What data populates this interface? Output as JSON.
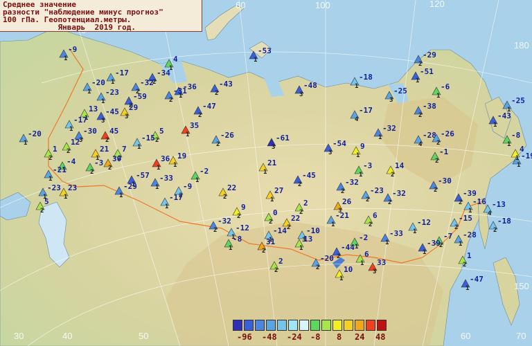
{
  "title": {
    "lines": [
      "Среднее значение",
      "разности \"наблюдение минус прогноз\"",
      "100 гПа. Геопотенциал.метры.",
      "            Январь  2019 год."
    ]
  },
  "legend": {
    "colors": [
      "#2f2fb8",
      "#3b5fd8",
      "#4a86e0",
      "#5aa4e4",
      "#74c4ec",
      "#9ee6f4",
      "#d8f6f8",
      "#5cd65c",
      "#a6e64a",
      "#f0f020",
      "#f4d020",
      "#f0a818",
      "#f04020",
      "#c01010"
    ],
    "labels": [
      "-96",
      "-48",
      "-24",
      "-8",
      "8",
      "24",
      "48"
    ]
  },
  "grid_labels": {
    "longitudes": [
      "40",
      "60",
      "70",
      "80",
      "100",
      "120",
      "140",
      "150",
      "160",
      "170",
      "180",
      "30",
      "40",
      "50",
      "60",
      "70"
    ],
    "latitudes_right": [
      "180",
      "170",
      "160",
      "150",
      "140",
      "130",
      "120",
      "110"
    ]
  },
  "stations": [
    {
      "v": "-9",
      "n": "1",
      "c": "#4a86e0"
    },
    {
      "v": "4",
      "n": "1",
      "c": "#5cd65c"
    },
    {
      "v": "-53",
      "n": "1",
      "c": "#3b5fd8"
    },
    {
      "v": "-17",
      "n": "1",
      "c": "#5aa4e4"
    },
    {
      "v": "-34",
      "n": "2",
      "c": "#3b5fd8"
    },
    {
      "v": "-20",
      "n": "1",
      "c": "#5aa4e4"
    },
    {
      "v": "-32",
      "n": "2",
      "c": "#4a86e0"
    },
    {
      "v": "-23",
      "n": "1",
      "c": "#5aa4e4"
    },
    {
      "v": "-36",
      "n": "1",
      "c": "#3b5fd8"
    },
    {
      "v": "-43",
      "n": "2",
      "c": "#3b5fd8"
    },
    {
      "v": "-48",
      "n": "3",
      "c": "#3b5fd8"
    },
    {
      "v": "-18",
      "n": "1",
      "c": "#74c4ec"
    },
    {
      "v": "-29",
      "n": "2",
      "c": "#4a86e0"
    },
    {
      "v": "-51",
      "n": "1",
      "c": "#3b5fd8"
    },
    {
      "v": "-47",
      "n": "2",
      "c": "#3b5fd8"
    },
    {
      "v": "-59",
      "n": "2",
      "c": "#3b5fd8"
    },
    {
      "v": "-31",
      "n": "2",
      "c": "#4a86e0"
    },
    {
      "v": "-25",
      "n": "3",
      "c": "#5aa4e4"
    },
    {
      "v": "-6",
      "n": "1",
      "c": "#5cd65c"
    },
    {
      "v": "-25",
      "n": "1",
      "c": "#5aa4e4"
    },
    {
      "v": "13",
      "n": "1",
      "c": "#a6e64a"
    },
    {
      "v": "-45",
      "n": "3",
      "c": "#3b5fd8"
    },
    {
      "v": "29",
      "n": "3",
      "c": "#f4d020"
    },
    {
      "v": "-17",
      "n": "4",
      "c": "#5aa4e4"
    },
    {
      "v": "-38",
      "n": "2",
      "c": "#4a86e0"
    },
    {
      "v": "-43",
      "n": "1",
      "c": "#3b5fd8"
    },
    {
      "v": "-17",
      "n": "1",
      "c": "#74c4ec"
    },
    {
      "v": "-30",
      "n": "3",
      "c": "#4a86e0"
    },
    {
      "v": "35",
      "n": "1",
      "c": "#f04020"
    },
    {
      "v": "5",
      "n": "2",
      "c": "#a6e64a"
    },
    {
      "v": "-26",
      "n": "2",
      "c": "#5aa4e4"
    },
    {
      "v": "-61",
      "n": "3",
      "c": "#2f2fb8"
    },
    {
      "v": "-32",
      "n": "1",
      "c": "#4a86e0"
    },
    {
      "v": "-28",
      "n": "4",
      "c": "#5aa4e4"
    },
    {
      "v": "-26",
      "n": "2",
      "c": "#5aa4e4"
    },
    {
      "v": "-8",
      "n": "1",
      "c": "#5cd65c"
    },
    {
      "v": "-20",
      "n": "1",
      "c": "#5aa4e4"
    },
    {
      "v": "-19",
      "n": "1",
      "c": "#5aa4e4"
    },
    {
      "v": "12",
      "n": "2",
      "c": "#a6e64a"
    },
    {
      "v": "45",
      "n": "2",
      "c": "#f04020"
    },
    {
      "v": "-15",
      "n": "1",
      "c": "#74c4ec"
    },
    {
      "v": "-54",
      "n": "3",
      "c": "#3b5fd8"
    },
    {
      "v": "9",
      "n": "1",
      "c": "#f0f020"
    },
    {
      "v": "-1",
      "n": "2",
      "c": "#5cd65c"
    },
    {
      "v": "-3",
      "n": "1",
      "c": "#5cd65c"
    },
    {
      "v": "4",
      "n": "1",
      "c": "#f0f020"
    },
    {
      "v": "1",
      "n": "2",
      "c": "#a6e64a"
    },
    {
      "v": "-4",
      "n": "1",
      "c": "#5cd65c"
    },
    {
      "v": "21",
      "n": "1",
      "c": "#f4d020"
    },
    {
      "v": "7",
      "n": "2",
      "c": "#a6e64a"
    },
    {
      "v": "30",
      "n": "2",
      "c": "#f0a818"
    },
    {
      "v": "36",
      "n": "1",
      "c": "#f04020"
    },
    {
      "v": "19",
      "n": "1",
      "c": "#f4d020"
    },
    {
      "v": "21",
      "n": "1",
      "c": "#f4d020"
    },
    {
      "v": "14",
      "n": "2",
      "c": "#f0f020"
    },
    {
      "v": "-21",
      "n": "1",
      "c": "#5aa4e4"
    },
    {
      "v": "-3",
      "n": "2",
      "c": "#5cd65c"
    },
    {
      "v": "-57",
      "n": "1",
      "c": "#3b5fd8"
    },
    {
      "v": "-2",
      "n": "1",
      "c": "#5cd65c"
    },
    {
      "v": "-45",
      "n": "2",
      "c": "#3b5fd8"
    },
    {
      "v": "-32",
      "n": "2",
      "c": "#4a86e0"
    },
    {
      "v": "-30",
      "n": "2",
      "c": "#4a86e0"
    },
    {
      "v": "-29",
      "n": "1",
      "c": "#4a86e0"
    },
    {
      "v": "-33",
      "n": "1",
      "c": "#4a86e0"
    },
    {
      "v": "-9",
      "n": "2",
      "c": "#74c4ec"
    },
    {
      "v": "22",
      "n": "2",
      "c": "#f4d020"
    },
    {
      "v": "27",
      "n": "1",
      "c": "#f4d020"
    },
    {
      "v": "-23",
      "n": "2",
      "c": "#5aa4e4"
    },
    {
      "v": "-32",
      "n": "2",
      "c": "#4a86e0"
    },
    {
      "v": "-39",
      "n": "2",
      "c": "#3b5fd8"
    },
    {
      "v": "-23",
      "n": "1",
      "c": "#5aa4e4"
    },
    {
      "v": "23",
      "n": "1",
      "c": "#f4d020"
    },
    {
      "v": "-17",
      "n": "1",
      "c": "#74c4ec"
    },
    {
      "v": "2",
      "n": "2",
      "c": "#a6e64a"
    },
    {
      "v": "26",
      "n": "3",
      "c": "#f0a818"
    },
    {
      "v": "-16",
      "n": "1",
      "c": "#74c4ec"
    },
    {
      "v": "-13",
      "n": "4",
      "c": "#74c4ec"
    },
    {
      "v": "-15",
      "n": "2",
      "c": "#74c4ec"
    },
    {
      "v": "-18",
      "n": "2",
      "c": "#74c4ec"
    },
    {
      "v": "5",
      "n": "2",
      "c": "#a6e64a"
    },
    {
      "v": "9",
      "n": "2",
      "c": "#f0f020"
    },
    {
      "v": "0",
      "n": "2",
      "c": "#a6e64a"
    },
    {
      "v": "22",
      "n": "2",
      "c": "#f4d020"
    },
    {
      "v": "-21",
      "n": "1",
      "c": "#5aa4e4"
    },
    {
      "v": "6",
      "n": "2",
      "c": "#a6e64a"
    },
    {
      "v": "-12",
      "n": "1",
      "c": "#74c4ec"
    },
    {
      "v": "-32",
      "n": "2",
      "c": "#4a86e0"
    },
    {
      "v": "-12",
      "n": "1",
      "c": "#74c4ec"
    },
    {
      "v": "-14",
      "n": "1",
      "c": "#74c4ec"
    },
    {
      "v": "-10",
      "n": "3",
      "c": "#74c4ec"
    },
    {
      "v": "-33",
      "n": "1",
      "c": "#4a86e0"
    },
    {
      "v": "-7",
      "n": "2",
      "c": "#5cd65c"
    },
    {
      "v": "-28",
      "n": "1",
      "c": "#5aa4e4"
    },
    {
      "v": "-8",
      "n": "1",
      "c": "#5cd65c"
    },
    {
      "v": "31",
      "n": "2",
      "c": "#f0a818"
    },
    {
      "v": "13",
      "n": "1",
      "c": "#a6e64a"
    },
    {
      "v": "-2",
      "n": "1",
      "c": "#5cd65c"
    },
    {
      "v": "-44",
      "n": "2",
      "c": "#3b5fd8"
    },
    {
      "v": "-39",
      "n": "1",
      "c": "#3b5fd8"
    },
    {
      "v": "6",
      "n": "1",
      "c": "#a6e64a"
    },
    {
      "v": "33",
      "n": "3",
      "c": "#f04020"
    },
    {
      "v": "-20",
      "n": "2",
      "c": "#5aa4e4"
    },
    {
      "v": "1",
      "n": "2",
      "c": "#a6e64a"
    },
    {
      "v": "2",
      "n": "2",
      "c": "#a6e64a"
    },
    {
      "v": "10",
      "n": "1",
      "c": "#f0f020"
    },
    {
      "v": "-47",
      "n": "1",
      "c": "#3b5fd8"
    },
    {
      "v": "16",
      "n": "2",
      "c": "#f4d020"
    },
    {
      "v": "22",
      "n": "1",
      "c": "#f0a818"
    }
  ]
}
